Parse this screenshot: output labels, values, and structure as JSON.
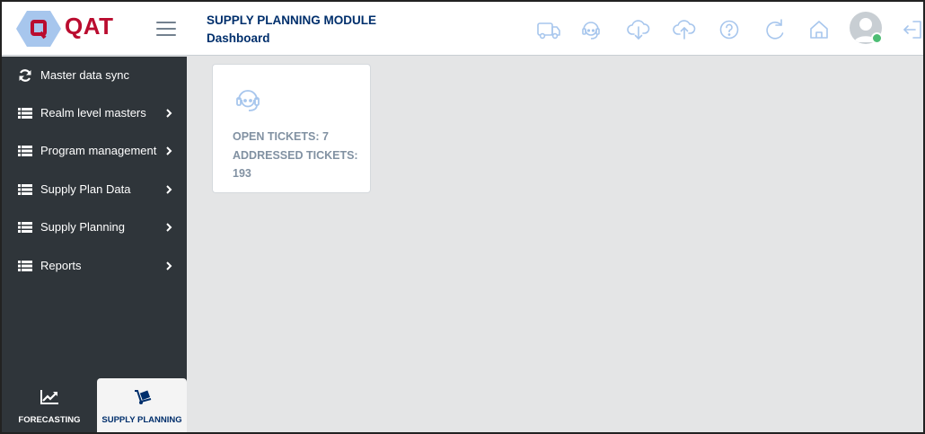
{
  "app": {
    "logo_text": "QAT",
    "brand_color": "#ba0c2f",
    "logo_bg_color": "#a7c6ed"
  },
  "header": {
    "module_title": "SUPPLY PLANNING MODULE",
    "page_title": "Dashboard",
    "icons": [
      "truck-icon",
      "support-headset-icon",
      "cloud-download-icon",
      "cloud-upload-icon",
      "help-icon",
      "refresh-icon",
      "home-icon",
      "user-avatar",
      "logout-icon"
    ],
    "icon_color": "#a7c6ed",
    "status_color": "#4dbd74"
  },
  "sidebar": {
    "items": [
      {
        "label": "Master data sync",
        "icon": "sync-icon",
        "has_submenu": false
      },
      {
        "label": "Realm level masters",
        "icon": "list-icon",
        "has_submenu": true
      },
      {
        "label": "Program management",
        "icon": "list-icon",
        "has_submenu": true
      },
      {
        "label": "Supply Plan Data",
        "icon": "list-icon",
        "has_submenu": true
      },
      {
        "label": "Supply Planning",
        "icon": "list-icon",
        "has_submenu": true
      },
      {
        "label": "Reports",
        "icon": "list-icon",
        "has_submenu": true
      }
    ],
    "bg_color": "#2f353a",
    "tabs": [
      {
        "label": "FORECASTING",
        "icon": "chart-line-icon",
        "active": false
      },
      {
        "label": "SUPPLY PLANNING",
        "icon": "dolly-icon",
        "active": true
      }
    ]
  },
  "tickets_card": {
    "icon": "support-headset-icon",
    "open_line": "OPEN TICKETS: 7",
    "addressed_line_1": "ADDRESSED TICKETS:",
    "addressed_line_2": "193",
    "open_count": 7,
    "addressed_count": 193
  }
}
